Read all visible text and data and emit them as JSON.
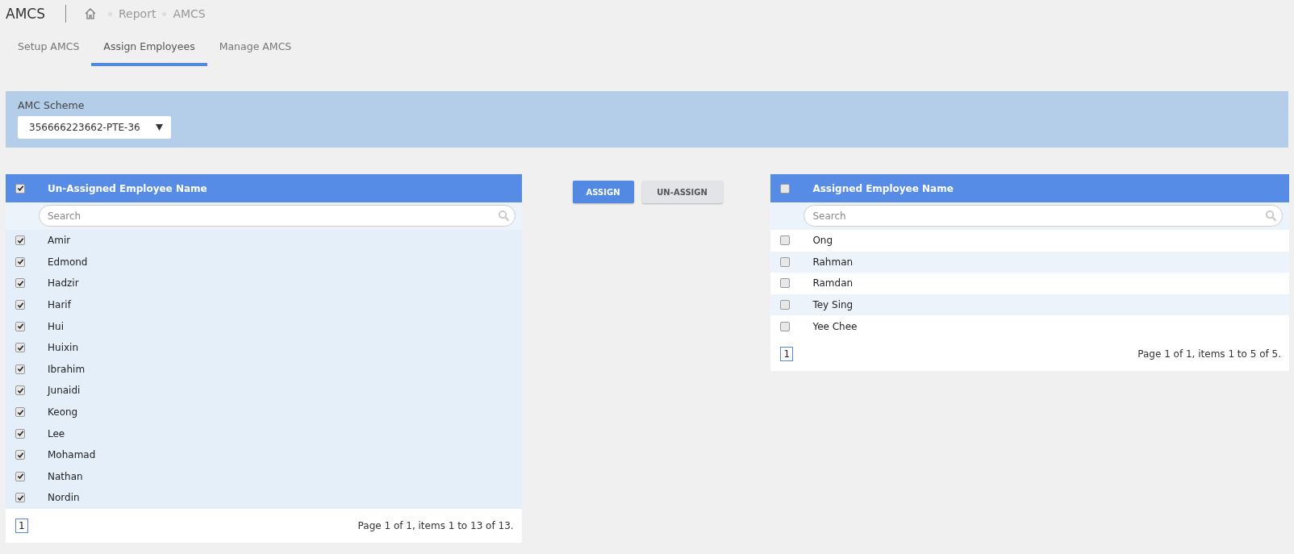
{
  "page_title": "AMCS",
  "breadcrumb": [
    "Report",
    "AMCS"
  ],
  "tabs": [
    {
      "label": "Setup AMCS",
      "selected": false
    },
    {
      "label": "Assign Employees",
      "selected": true
    },
    {
      "label": "Manage AMCS",
      "selected": false
    }
  ],
  "scheme": {
    "label": "AMC Scheme",
    "value": "356666223662-PTE-36"
  },
  "unassigned": {
    "header": "Un-Assigned Employee Name",
    "all_checked": true,
    "search": {
      "placeholder": "Search"
    },
    "rows": [
      {
        "name": "Amir",
        "checked": true
      },
      {
        "name": "Edmond",
        "checked": true
      },
      {
        "name": "Hadzir",
        "checked": true
      },
      {
        "name": "Harif",
        "checked": true
      },
      {
        "name": "Hui",
        "checked": true
      },
      {
        "name": "Huixin",
        "checked": true
      },
      {
        "name": "Ibrahim",
        "checked": true
      },
      {
        "name": "Junaidi",
        "checked": true
      },
      {
        "name": "Keong",
        "checked": true
      },
      {
        "name": "Lee",
        "checked": true
      },
      {
        "name": "Mohamad",
        "checked": true
      },
      {
        "name": "Nathan",
        "checked": true
      },
      {
        "name": "Nordin",
        "checked": true
      }
    ],
    "page": "1",
    "summary": "Page 1 of 1, items 1 to 13 of 13."
  },
  "buttons": [
    {
      "label": "ASSIGN",
      "kind": "primary"
    },
    {
      "label": "UN-ASSIGN",
      "kind": "secondary"
    }
  ],
  "assigned": {
    "header": "Assigned Employee Name",
    "all_checked": false,
    "search": {
      "placeholder": "Search"
    },
    "rows": [
      {
        "name": "Ong",
        "checked": false
      },
      {
        "name": "Rahman",
        "checked": false
      },
      {
        "name": "Ramdan",
        "checked": false
      },
      {
        "name": "Tey Sing",
        "checked": false
      },
      {
        "name": "Yee Chee",
        "checked": false
      }
    ],
    "page": "1",
    "summary": "Page 1 of 1, items 1 to 5 of 5."
  }
}
